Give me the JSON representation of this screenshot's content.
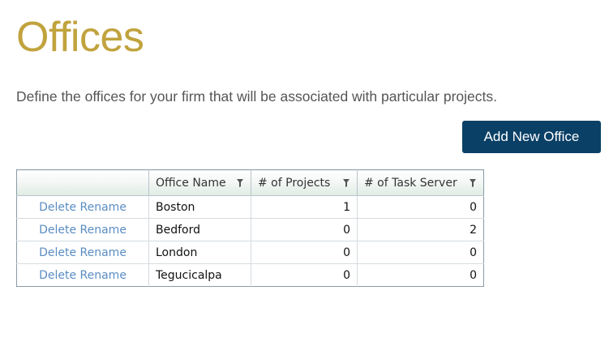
{
  "header": {
    "title": "Offices",
    "description": "Define the offices for your firm that will be associated with particular projects."
  },
  "toolbar": {
    "add_label": "Add New Office"
  },
  "table": {
    "columns": [
      "",
      "Office Name",
      "# of Projects",
      "# of Task Server"
    ],
    "filter_icon": "filter-icon",
    "rows": [
      {
        "delete": "Delete",
        "rename": "Rename",
        "name": "Boston",
        "projects": "1",
        "task_server": "0"
      },
      {
        "delete": "Delete",
        "rename": "Rename",
        "name": "Bedford",
        "projects": "0",
        "task_server": "2"
      },
      {
        "delete": "Delete",
        "rename": "Rename",
        "name": "London",
        "projects": "0",
        "task_server": "0"
      },
      {
        "delete": "Delete",
        "rename": "Rename",
        "name": "Tegucicalpa",
        "projects": "0",
        "task_server": "0"
      }
    ]
  },
  "colors": {
    "title": "#c1a33e",
    "button": "#0b4066",
    "link": "#5a8dc2"
  }
}
